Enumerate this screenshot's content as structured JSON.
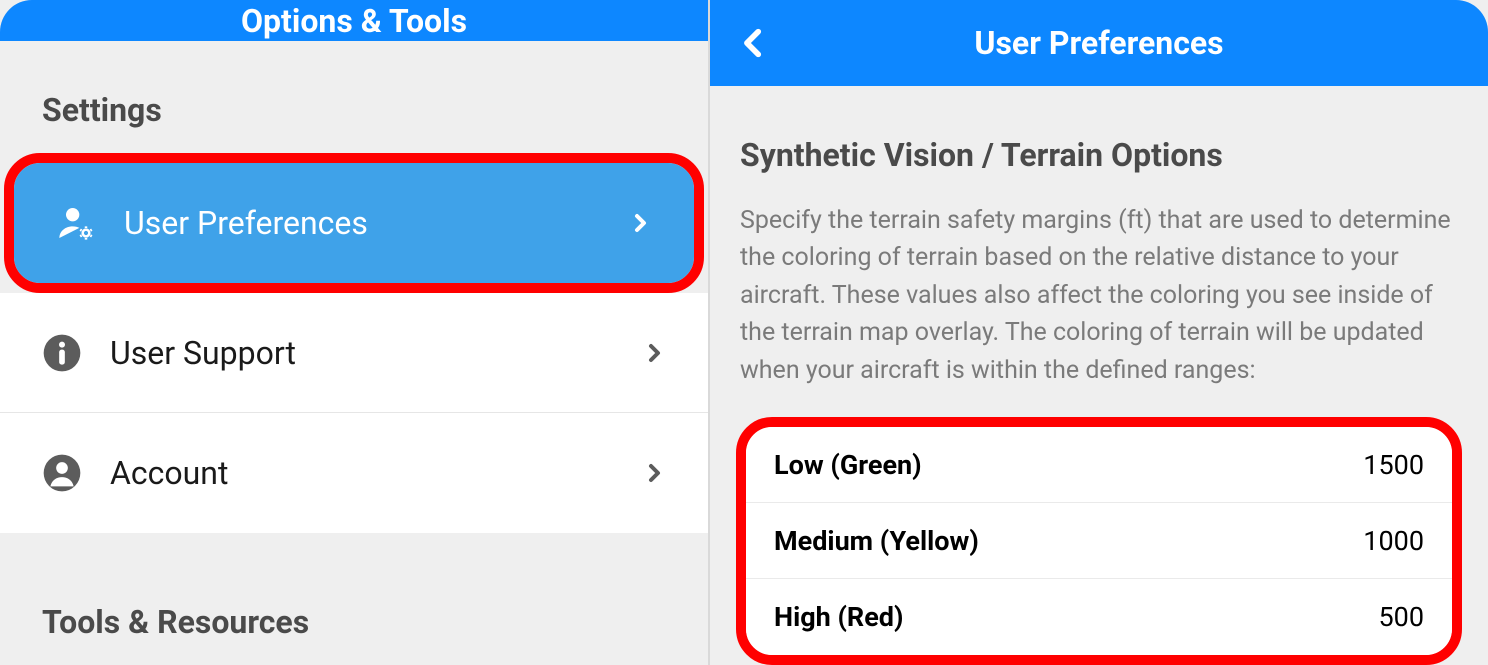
{
  "left": {
    "header_title": "Options & Tools",
    "sections": {
      "settings_header": "Settings",
      "tools_header": "Tools & Resources",
      "items": [
        {
          "label": "User Preferences",
          "icon": "user-gear-icon",
          "selected": true
        },
        {
          "label": "User Support",
          "icon": "info-icon",
          "selected": false
        },
        {
          "label": "Account",
          "icon": "account-icon",
          "selected": false
        }
      ]
    }
  },
  "right": {
    "header_title": "User Preferences",
    "content_title": "Synthetic Vision / Terrain Options",
    "content_description": "Specify the terrain safety margins (ft) that are used to determine the coloring of terrain based on the relative distance to your aircraft. These values also affect the coloring you see inside of the terrain map overlay. The coloring of terrain will be updated when your aircraft is within the defined ranges:",
    "terrain_rows": [
      {
        "label": "Low (Green)",
        "value": "1500"
      },
      {
        "label": "Medium (Yellow)",
        "value": "1000"
      },
      {
        "label": "High (Red)",
        "value": "500"
      }
    ]
  },
  "colors": {
    "primary_blue": "#0d87ff",
    "selected_blue": "#3fa2e9",
    "highlight_red": "#ff0000"
  }
}
